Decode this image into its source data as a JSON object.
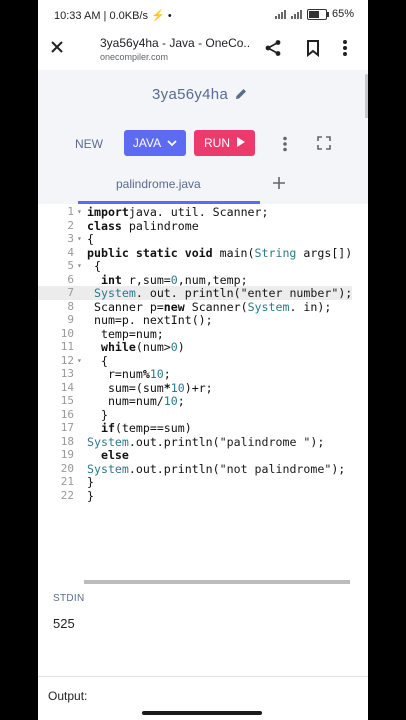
{
  "status": {
    "time": "10:33 AM",
    "speed": "0.0KB/s",
    "battery": "65%",
    "battery_level": 0.65
  },
  "browser": {
    "page_title": "3ya56y4ha - Java - OneCo...",
    "domain": "onecompiler.com",
    "icons": [
      "close-icon",
      "share-icon",
      "bookmark-icon",
      "more-vert-icon"
    ]
  },
  "project": {
    "name": "3ya56y4ha"
  },
  "toolbar": {
    "new_label": "NEW",
    "lang_label": "JAVA",
    "run_label": "RUN"
  },
  "tabs": {
    "file": "palindrome.java"
  },
  "editor": {
    "active_line": 7,
    "fold_lines": [
      1,
      3,
      5,
      12
    ],
    "lines": [
      [
        [
          "kw",
          "import"
        ],
        [
          "",
          "java. util. Scanner;"
        ]
      ],
      [
        [
          "kw",
          "class"
        ],
        [
          "",
          " palindrome"
        ]
      ],
      [
        [
          "",
          "{"
        ]
      ],
      [
        [
          "kw",
          "public static void"
        ],
        [
          "",
          " main("
        ],
        [
          "ty",
          "String"
        ],
        [
          "",
          " args[])"
        ]
      ],
      [
        [
          "",
          ""
        ],
        [
          "",
          " {"
        ]
      ],
      [
        [
          "",
          "  "
        ],
        [
          "kw",
          "int"
        ],
        [
          "",
          " r,sum="
        ],
        [
          "nm",
          "0"
        ],
        [
          "",
          ",num,temp;"
        ]
      ],
      [
        [
          "",
          " "
        ],
        [
          "ty",
          "System"
        ],
        [
          "",
          ". out. println("
        ],
        [
          "st",
          "\"enter number\""
        ],
        [
          "",
          ");"
        ]
      ],
      [
        [
          "",
          " Scanner p="
        ],
        [
          "kw",
          "new"
        ],
        [
          "",
          " Scanner("
        ],
        [
          "ty",
          "System"
        ],
        [
          "",
          ". in);"
        ]
      ],
      [
        [
          "",
          " num=p. nextInt();"
        ]
      ],
      [
        [
          "",
          "  temp=num;"
        ]
      ],
      [
        [
          "",
          "  "
        ],
        [
          "kw",
          "while"
        ],
        [
          "",
          "(num>"
        ],
        [
          "nm",
          "0"
        ],
        [
          "",
          ")"
        ]
      ],
      [
        [
          "",
          "  {"
        ]
      ],
      [
        [
          "",
          "   r=num"
        ],
        [
          "kw",
          "%"
        ],
        [
          "nm",
          "10"
        ],
        [
          "",
          ";"
        ]
      ],
      [
        [
          "",
          "   sum=(sum"
        ],
        [
          "kw",
          "*"
        ],
        [
          "nm",
          "10"
        ],
        [
          "",
          ")+r;"
        ]
      ],
      [
        [
          "",
          "   num=num/"
        ],
        [
          "nm",
          "10"
        ],
        [
          "",
          ";"
        ]
      ],
      [
        [
          "",
          "  }"
        ]
      ],
      [
        [
          "",
          "  "
        ],
        [
          "kw",
          "if"
        ],
        [
          "",
          "(temp==sum)"
        ]
      ],
      [
        [
          "ty",
          "System"
        ],
        [
          "",
          ".out.println("
        ],
        [
          "st",
          "\"palindrome \""
        ],
        [
          "",
          ");"
        ]
      ],
      [
        [
          "",
          "  "
        ],
        [
          "kw",
          "else"
        ]
      ],
      [
        [
          "ty",
          "System"
        ],
        [
          "",
          ".out.println("
        ],
        [
          "st",
          "\"not palindrome\""
        ],
        [
          "",
          ");"
        ]
      ],
      [
        [
          "",
          "}"
        ]
      ],
      [
        [
          "",
          "}"
        ]
      ]
    ]
  },
  "stdin": {
    "label": "STDIN",
    "value": "525"
  },
  "output": {
    "label": "Output:"
  }
}
